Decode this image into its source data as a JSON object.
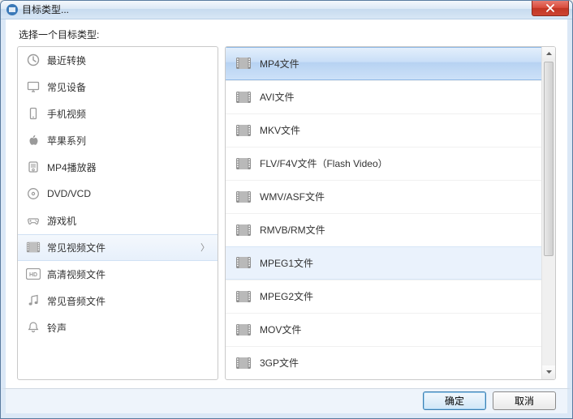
{
  "window": {
    "title": "目标类型..."
  },
  "prompt": "选择一个目标类型:",
  "categories": [
    {
      "icon": "clock-icon",
      "label": "最近转换"
    },
    {
      "icon": "monitor-icon",
      "label": "常见设备"
    },
    {
      "icon": "phone-icon",
      "label": "手机视频"
    },
    {
      "icon": "apple-icon",
      "label": "苹果系列"
    },
    {
      "icon": "player-icon",
      "label": "MP4播放器"
    },
    {
      "icon": "disc-icon",
      "label": "DVD/VCD"
    },
    {
      "icon": "gamepad-icon",
      "label": "游戏机"
    },
    {
      "icon": "film-icon",
      "label": "常见视频文件",
      "selected": true
    },
    {
      "icon": "hd-icon",
      "label": "高清视频文件"
    },
    {
      "icon": "music-icon",
      "label": "常见音频文件"
    },
    {
      "icon": "bell-icon",
      "label": "铃声"
    }
  ],
  "formats": [
    {
      "label": "MP4文件",
      "selected": true
    },
    {
      "label": "AVI文件"
    },
    {
      "label": "MKV文件"
    },
    {
      "label": "FLV/F4V文件（Flash Video）"
    },
    {
      "label": "WMV/ASF文件"
    },
    {
      "label": "RMVB/RM文件"
    },
    {
      "label": "MPEG1文件",
      "hovered": true
    },
    {
      "label": "MPEG2文件"
    },
    {
      "label": "MOV文件"
    },
    {
      "label": "3GP文件"
    }
  ],
  "buttons": {
    "ok": "确定",
    "cancel": "取消"
  }
}
